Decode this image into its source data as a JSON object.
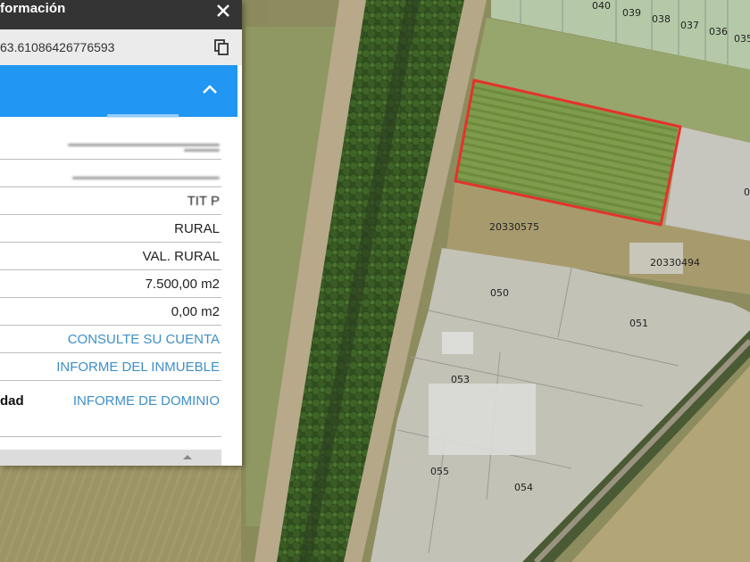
{
  "panel": {
    "title": "formación",
    "coordinate": "63.61086426776593",
    "rows": [
      {
        "label": "",
        "value": "",
        "kind": "blurred"
      },
      {
        "label": "",
        "value": "",
        "kind": "blurred"
      },
      {
        "label": "",
        "value": "TIT P",
        "kind": "value"
      },
      {
        "label": "",
        "value": "RURAL",
        "kind": "value"
      },
      {
        "label": "",
        "value": "VAL. RURAL",
        "kind": "value"
      },
      {
        "label": "",
        "value": "7.500,00 m2",
        "kind": "value"
      },
      {
        "label": "",
        "value": "0,00 m2",
        "kind": "value"
      },
      {
        "label": "",
        "value": "CONSULTE SU CUENTA",
        "kind": "link"
      },
      {
        "label": "",
        "value": "INFORME DEL INMUEBLE",
        "kind": "link"
      },
      {
        "label": "dad",
        "value": "INFORME DE DOMINIO",
        "kind": "link"
      }
    ],
    "colors": {
      "header": "#343434",
      "section": "#2196f3",
      "link": "#3e8fc9"
    }
  },
  "map": {
    "parcels": [
      "040",
      "039",
      "038",
      "037",
      "036",
      "035",
      "20330575",
      "20330494",
      "050",
      "051",
      "053",
      "055",
      "054",
      "0"
    ],
    "highlight_color": "#e5322b"
  }
}
